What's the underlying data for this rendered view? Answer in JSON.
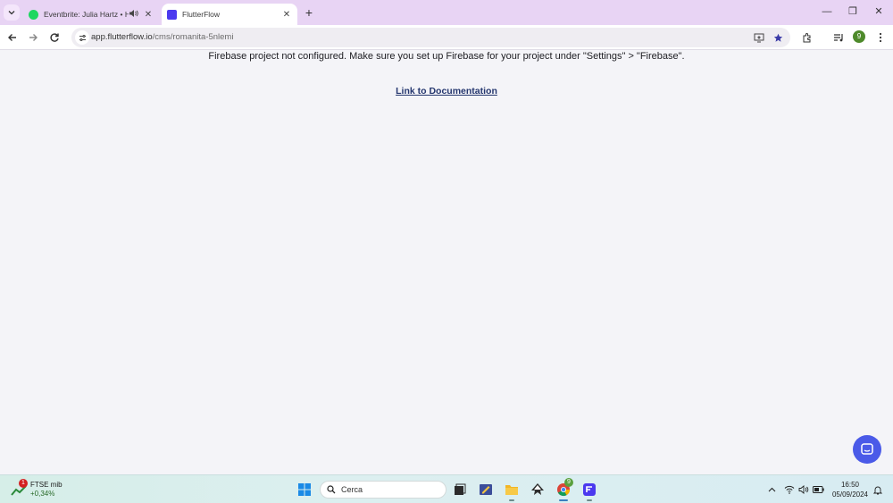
{
  "browser": {
    "tabs": [
      {
        "title": "Eventbrite: Julia Hartz • How",
        "active": false,
        "favicon_color": "#1ed760"
      },
      {
        "title": "FlutterFlow",
        "active": true,
        "favicon_color": "#4b39ef"
      }
    ],
    "omnibox": {
      "host": "app.flutterflow.io",
      "path": "/cms/romanita-5nlemi"
    },
    "profile_initial": "9"
  },
  "page": {
    "message": "Firebase project not configured. Make sure you set up Firebase for your project under \"Settings\" > \"Firebase\".",
    "link_label": "Link to Documentation"
  },
  "taskbar": {
    "widget_badge": "1",
    "widget_name": "FTSE mib",
    "widget_change": "+0,34%",
    "search_placeholder": "Cerca",
    "chrome_badge": "9",
    "time": "16:50",
    "date": "05/09/2024"
  },
  "colors": {
    "tabstrip": "#e8d4f4",
    "link": "#24366e",
    "chat_button": "#4a5ae8",
    "flutterflow": "#4b39ef"
  }
}
